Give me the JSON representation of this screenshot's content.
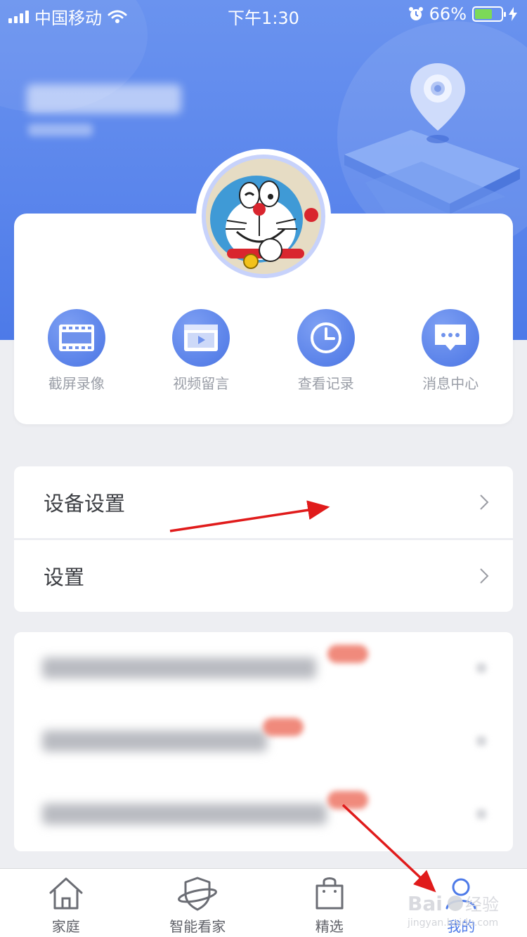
{
  "status_bar": {
    "carrier": "中国移动",
    "time": "下午1:30",
    "battery": "66%",
    "battery_level": 0.66
  },
  "quick_actions": [
    {
      "label": "截屏录像",
      "icon": "film-strip-icon"
    },
    {
      "label": "视频留言",
      "icon": "video-play-icon"
    },
    {
      "label": "查看记录",
      "icon": "clock-icon"
    },
    {
      "label": "消息中心",
      "icon": "message-bubble-icon"
    }
  ],
  "settings_list": [
    {
      "label": "设备设置"
    },
    {
      "label": "设置"
    }
  ],
  "tab_bar": {
    "tabs": [
      {
        "label": "家庭",
        "icon": "home-icon"
      },
      {
        "label": "智能看家",
        "icon": "shield-icon"
      },
      {
        "label": "精选",
        "icon": "shopping-bag-icon"
      },
      {
        "label": "我的",
        "icon": "user-icon",
        "active": true
      }
    ]
  },
  "colors": {
    "accent": "#4d7ae8",
    "header_start": "#6a93ef",
    "annotation": "#e01b1b"
  }
}
